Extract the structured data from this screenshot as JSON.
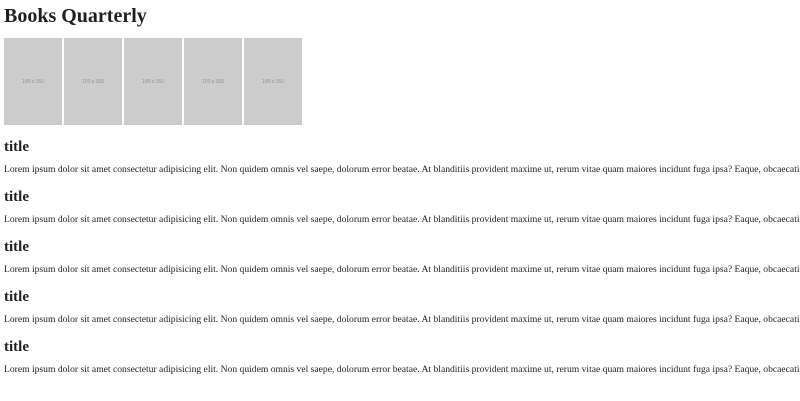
{
  "site": {
    "title": "Books Quarterly"
  },
  "thumbnails": [
    {
      "label": "100 x 150"
    },
    {
      "label": "100 x 150"
    },
    {
      "label": "100 x 150"
    },
    {
      "label": "100 x 150"
    },
    {
      "label": "100 x 150"
    }
  ],
  "articles": [
    {
      "title": "title",
      "body": "Lorem ipsum dolor sit amet consectetur adipisicing elit. Non quidem omnis vel saepe, dolorum error beatae. At blanditiis provident maxime ut, rerum vitae quam maiores incidunt fuga ipsa? Eaque, obcaecati?"
    },
    {
      "title": "title",
      "body": "Lorem ipsum dolor sit amet consectetur adipisicing elit. Non quidem omnis vel saepe, dolorum error beatae. At blanditiis provident maxime ut, rerum vitae quam maiores incidunt fuga ipsa? Eaque, obcaecati?"
    },
    {
      "title": "title",
      "body": "Lorem ipsum dolor sit amet consectetur adipisicing elit. Non quidem omnis vel saepe, dolorum error beatae. At blanditiis provident maxime ut, rerum vitae quam maiores incidunt fuga ipsa? Eaque, obcaecati?"
    },
    {
      "title": "title",
      "body": "Lorem ipsum dolor sit amet consectetur adipisicing elit. Non quidem omnis vel saepe, dolorum error beatae. At blanditiis provident maxime ut, rerum vitae quam maiores incidunt fuga ipsa? Eaque, obcaecati?"
    },
    {
      "title": "title",
      "body": "Lorem ipsum dolor sit amet consectetur adipisicing elit. Non quidem omnis vel saepe, dolorum error beatae. At blanditiis provident maxime ut, rerum vitae quam maiores incidunt fuga ipsa? Eaque, obcaecati?"
    }
  ]
}
